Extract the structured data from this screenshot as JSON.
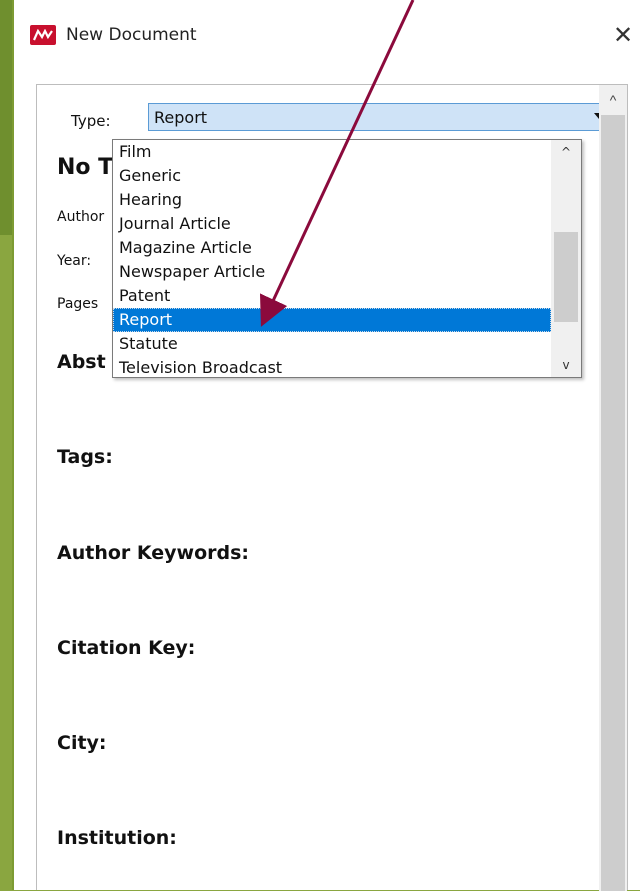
{
  "window": {
    "title": "New Document",
    "close_glyph": "✕"
  },
  "form": {
    "type_label": "Type:",
    "type_value": "Report",
    "doc_title_partial": "No T",
    "fields_partial": [
      "Author",
      "Year:",
      "Pages"
    ],
    "headings": {
      "abstract_partial": "Abst",
      "tags": "Tags:",
      "author_keywords": "Author Keywords:",
      "citation_key": "Citation Key:",
      "city": "City:",
      "institution": "Institution:"
    }
  },
  "dropdown": {
    "items": [
      "Film",
      "Generic",
      "Hearing",
      "Journal Article",
      "Magazine Article",
      "Newspaper Article",
      "Patent",
      "Report",
      "Statute",
      "Television Broadcast"
    ],
    "selected": "Report"
  },
  "icons": {
    "app": "mendeley-icon",
    "close": "close-icon",
    "dropdown_arrow": "chevron-down-icon",
    "scroll_up": "chevron-up-icon",
    "scroll_down": "chevron-down-icon"
  },
  "colors": {
    "background_frame": "#8aa640",
    "selection": "#0078d7",
    "select_bg": "#cfe3f7",
    "app_icon": "#c8102e",
    "annotation_arrow": "#8b0a3c"
  }
}
